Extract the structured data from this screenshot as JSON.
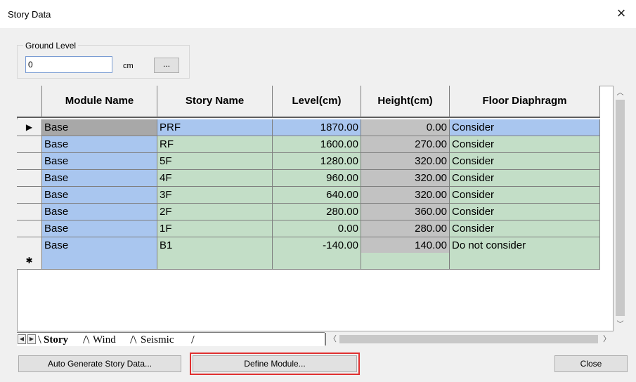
{
  "window": {
    "title": "Story Data",
    "close_glyph": "×"
  },
  "ground_level": {
    "label": "Ground Level",
    "value": "0",
    "unit": "cm",
    "browse_label": "..."
  },
  "grid": {
    "headers": [
      "Module Name",
      "Story Name",
      "Level(cm)",
      "Height(cm)",
      "Floor Diaphragm"
    ],
    "current_row_marker": "▶",
    "new_row_marker": "✱",
    "rows": [
      {
        "module": "Base",
        "story": "PRF",
        "level": "1870.00",
        "height": "0.00",
        "diaphragm": "Consider"
      },
      {
        "module": "Base",
        "story": "RF",
        "level": "1600.00",
        "height": "270.00",
        "diaphragm": "Consider"
      },
      {
        "module": "Base",
        "story": "5F",
        "level": "1280.00",
        "height": "320.00",
        "diaphragm": "Consider"
      },
      {
        "module": "Base",
        "story": "4F",
        "level": "960.00",
        "height": "320.00",
        "diaphragm": "Consider"
      },
      {
        "module": "Base",
        "story": "3F",
        "level": "640.00",
        "height": "320.00",
        "diaphragm": "Consider"
      },
      {
        "module": "Base",
        "story": "2F",
        "level": "280.00",
        "height": "360.00",
        "diaphragm": "Consider"
      },
      {
        "module": "Base",
        "story": "1F",
        "level": "0.00",
        "height": "280.00",
        "diaphragm": "Consider"
      },
      {
        "module": "Base",
        "story": "B1",
        "level": "-140.00",
        "height": "140.00",
        "diaphragm": "Do not consider"
      }
    ]
  },
  "tabs": [
    {
      "label": "Story",
      "active": true
    },
    {
      "label": "Wind",
      "active": false
    },
    {
      "label": "Seismic",
      "active": false
    }
  ],
  "buttons": {
    "auto_generate": "Auto Generate Story Data...",
    "define_module": "Define Module...",
    "close": "Close"
  },
  "colors": {
    "module_cell": "#a9c6ef",
    "data_cell": "#c3dec7",
    "highlight": "#e03030"
  }
}
